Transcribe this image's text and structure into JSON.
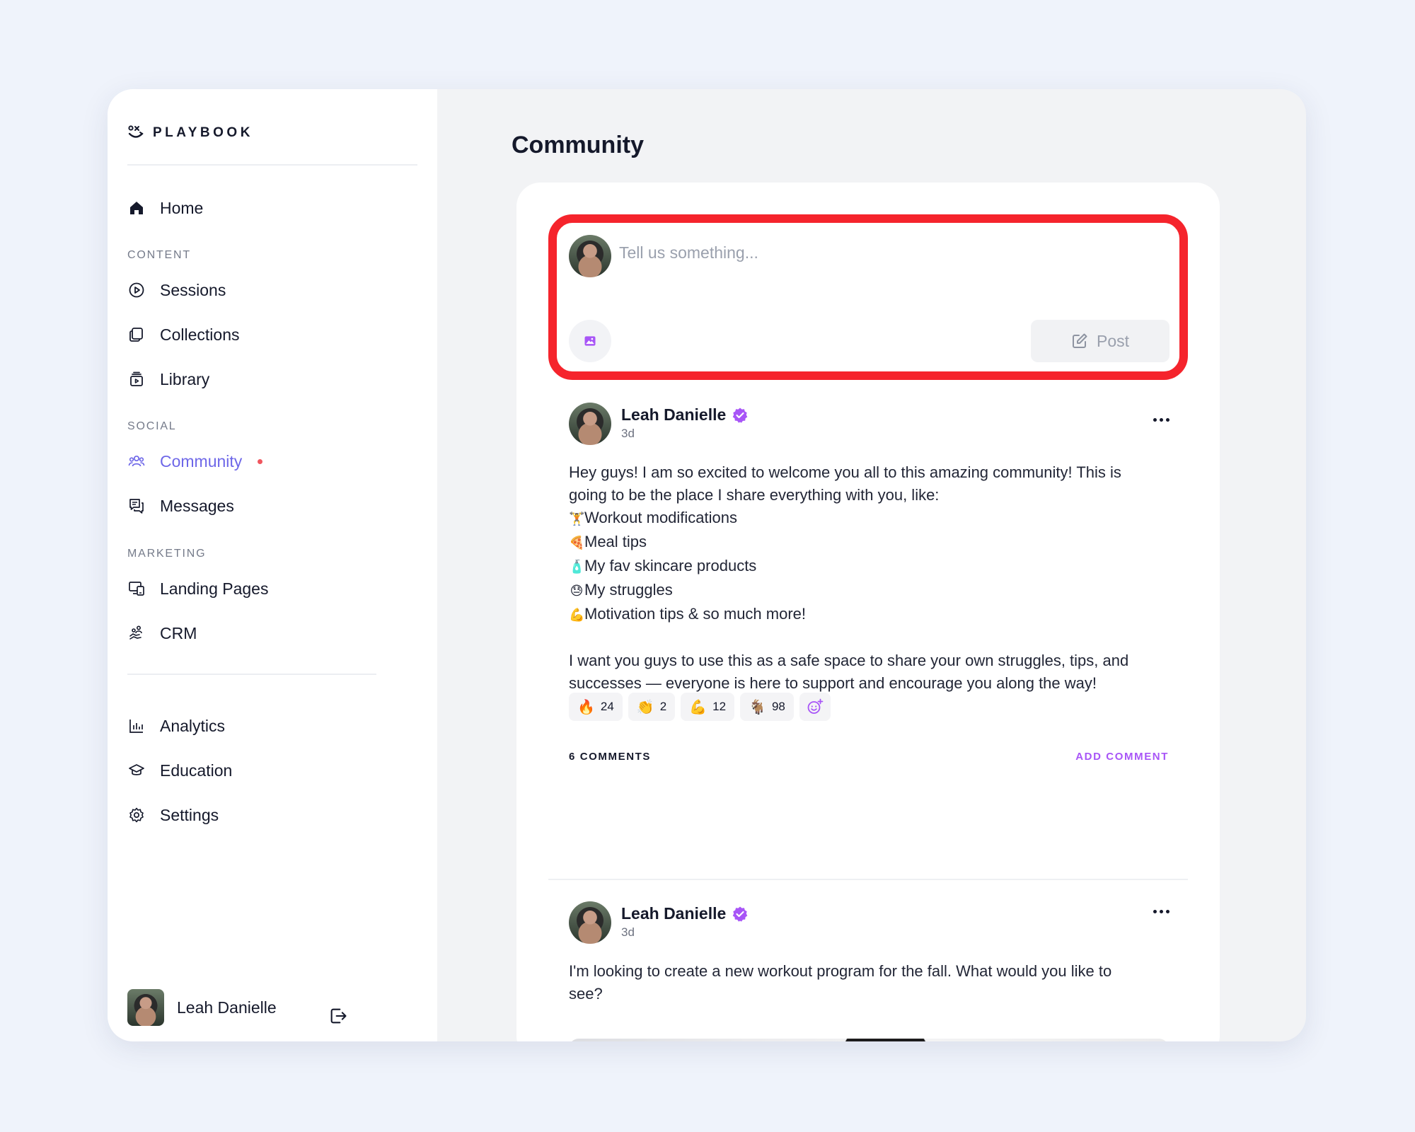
{
  "brand": {
    "name": "PLAYBOOK"
  },
  "sidebar": {
    "home": "Home",
    "sections": {
      "content": "CONTENT",
      "social": "SOCIAL",
      "marketing": "MARKETING"
    },
    "content_items": [
      "Sessions",
      "Collections",
      "Library"
    ],
    "social_items": [
      "Community",
      "Messages"
    ],
    "marketing_items": [
      "Landing Pages",
      "CRM"
    ],
    "bottom_items": [
      "Analytics",
      "Education",
      "Settings"
    ],
    "active_item": "Community",
    "user_name": "Leah Danielle"
  },
  "main": {
    "title": "Community",
    "composer": {
      "placeholder": "Tell us something...",
      "post_label": "Post",
      "highlight_color": "#f5242c"
    },
    "posts": [
      {
        "author": "Leah Danielle",
        "time": "3d",
        "lines": [
          "Hey guys! I am so excited to welcome you all to this amazing community! This is",
          "going to be the place I share everything with you, like:",
          "Workout modifications",
          "Meal tips",
          "My fav skincare products",
          "My struggles",
          "Motivation tips & so much more!",
          "I want you guys to use this as a safe space to share your own struggles, tips, and",
          "successes — everyone is here to support and encourage you along the way!"
        ],
        "list_emojis": [
          "🏋",
          "🍕",
          "🧴",
          "😓",
          "💪"
        ],
        "reactions": [
          {
            "emoji": "🔥",
            "count": "24"
          },
          {
            "emoji": "👏",
            "count": "2"
          },
          {
            "emoji": "💪",
            "count": "12"
          },
          {
            "emoji": "🐐",
            "count": "98"
          }
        ],
        "comments_label": "6 COMMENTS",
        "add_comment_label": "ADD COMMENT"
      },
      {
        "author": "Leah Danielle",
        "time": "3d",
        "lines": [
          "I'm looking to create a new workout program for the fall. What would you like to",
          "see?"
        ]
      }
    ]
  },
  "colors": {
    "accent": "#6e67e8",
    "verified": "#a855f7",
    "notification_dot": "#f0565f"
  }
}
